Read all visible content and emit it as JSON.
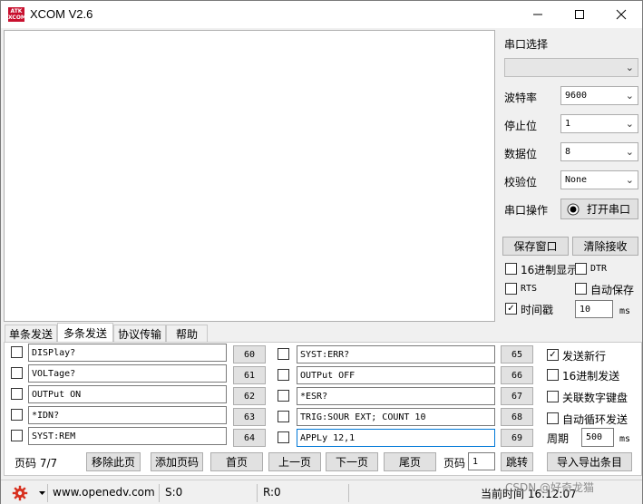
{
  "window": {
    "logo_text": "ATK XCOM",
    "title": "XCOM V2.6",
    "minimize_icon": "minimize-icon",
    "maximize_icon": "maximize-icon",
    "close_icon": "close-icon"
  },
  "serial": {
    "port_select_label": "串口选择",
    "port_value": "",
    "baud_label": "波特率",
    "baud_value": "9600",
    "stop_label": "停止位",
    "stop_value": "1",
    "data_label": "数据位",
    "data_value": "8",
    "parity_label": "校验位",
    "parity_value": "None",
    "operation_label": "串口操作",
    "open_button": "打开串口"
  },
  "receive": {
    "save_window": "保存窗口",
    "clear_receive": "清除接收",
    "hex_display": "16进制显示",
    "hex_display_checked": false,
    "dtr": "DTR",
    "dtr_checked": false,
    "rts": "RTS",
    "rts_checked": false,
    "auto_save": "自动保存",
    "auto_save_checked": false,
    "timestamp": "时间戳",
    "timestamp_checked": true,
    "timestamp_value": "10",
    "timestamp_unit": "ms"
  },
  "tabs": [
    {
      "label": "单条发送",
      "active": false
    },
    {
      "label": "多条发送",
      "active": true
    },
    {
      "label": "协议传输",
      "active": false
    },
    {
      "label": "帮助",
      "active": false
    }
  ],
  "multi_send": {
    "left": [
      {
        "text": "DISPlay?",
        "num": "60"
      },
      {
        "text": "VOLTage?",
        "num": "61"
      },
      {
        "text": "OUTPut ON",
        "num": "62"
      },
      {
        "text": "*IDN?",
        "num": "63"
      },
      {
        "text": "SYST:REM",
        "num": "64"
      }
    ],
    "right": [
      {
        "text": "SYST:ERR?",
        "num": "65"
      },
      {
        "text": "OUTPut OFF",
        "num": "66"
      },
      {
        "text": "*ESR?",
        "num": "67"
      },
      {
        "text": "TRIG:SOUR EXT; COUNT 10",
        "num": "68"
      },
      {
        "text": "APPLy 12,1",
        "num": "69"
      }
    ],
    "send_newline": "发送新行",
    "send_newline_checked": true,
    "hex_send": "16进制发送",
    "hex_send_checked": false,
    "link_keyboard": "关联数字键盘",
    "link_keyboard_checked": false,
    "auto_loop": "自动循环发送",
    "auto_loop_checked": false,
    "period_label": "周期",
    "period_value": "500",
    "period_unit": "ms",
    "page_info": "页码 7/7",
    "remove_page": "移除此页",
    "add_page": "添加页码",
    "first_page": "首页",
    "prev_page": "上一页",
    "next_page": "下一页",
    "last_page": "尾页",
    "page_label": "页码",
    "page_input": "1",
    "jump": "跳转",
    "import_export": "导入导出条目"
  },
  "status": {
    "gear_icon": "gear-icon",
    "website": "www.openedv.com",
    "sent": "S:0",
    "received": "R:0",
    "current_time": "当前时间 16:12:07",
    "watermark": "CSDN @好奇龙猫"
  }
}
